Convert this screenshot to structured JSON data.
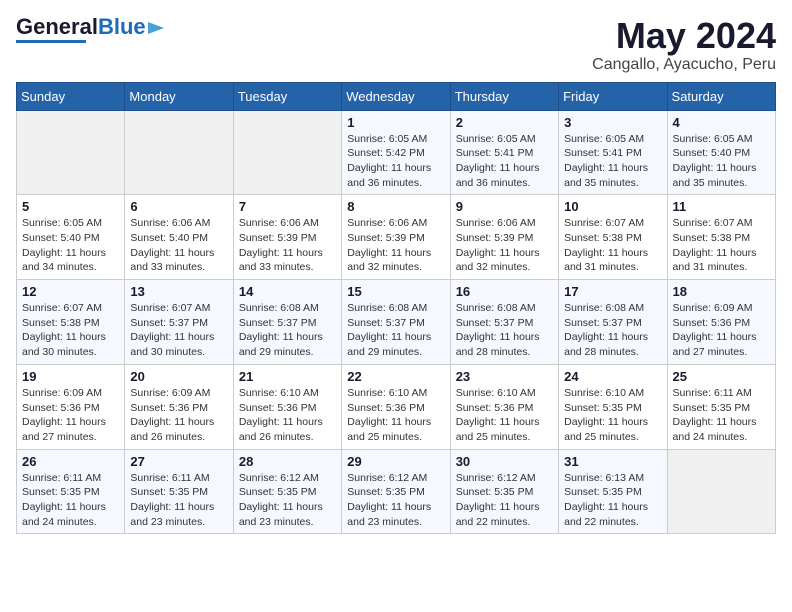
{
  "header": {
    "logo_line1": "General",
    "logo_line2": "Blue",
    "month": "May 2024",
    "location": "Cangallo, Ayacucho, Peru"
  },
  "weekdays": [
    "Sunday",
    "Monday",
    "Tuesday",
    "Wednesday",
    "Thursday",
    "Friday",
    "Saturday"
  ],
  "weeks": [
    [
      {
        "day": "",
        "info": ""
      },
      {
        "day": "",
        "info": ""
      },
      {
        "day": "",
        "info": ""
      },
      {
        "day": "1",
        "info": "Sunrise: 6:05 AM\nSunset: 5:42 PM\nDaylight: 11 hours\nand 36 minutes."
      },
      {
        "day": "2",
        "info": "Sunrise: 6:05 AM\nSunset: 5:41 PM\nDaylight: 11 hours\nand 36 minutes."
      },
      {
        "day": "3",
        "info": "Sunrise: 6:05 AM\nSunset: 5:41 PM\nDaylight: 11 hours\nand 35 minutes."
      },
      {
        "day": "4",
        "info": "Sunrise: 6:05 AM\nSunset: 5:40 PM\nDaylight: 11 hours\nand 35 minutes."
      }
    ],
    [
      {
        "day": "5",
        "info": "Sunrise: 6:05 AM\nSunset: 5:40 PM\nDaylight: 11 hours\nand 34 minutes."
      },
      {
        "day": "6",
        "info": "Sunrise: 6:06 AM\nSunset: 5:40 PM\nDaylight: 11 hours\nand 33 minutes."
      },
      {
        "day": "7",
        "info": "Sunrise: 6:06 AM\nSunset: 5:39 PM\nDaylight: 11 hours\nand 33 minutes."
      },
      {
        "day": "8",
        "info": "Sunrise: 6:06 AM\nSunset: 5:39 PM\nDaylight: 11 hours\nand 32 minutes."
      },
      {
        "day": "9",
        "info": "Sunrise: 6:06 AM\nSunset: 5:39 PM\nDaylight: 11 hours\nand 32 minutes."
      },
      {
        "day": "10",
        "info": "Sunrise: 6:07 AM\nSunset: 5:38 PM\nDaylight: 11 hours\nand 31 minutes."
      },
      {
        "day": "11",
        "info": "Sunrise: 6:07 AM\nSunset: 5:38 PM\nDaylight: 11 hours\nand 31 minutes."
      }
    ],
    [
      {
        "day": "12",
        "info": "Sunrise: 6:07 AM\nSunset: 5:38 PM\nDaylight: 11 hours\nand 30 minutes."
      },
      {
        "day": "13",
        "info": "Sunrise: 6:07 AM\nSunset: 5:37 PM\nDaylight: 11 hours\nand 30 minutes."
      },
      {
        "day": "14",
        "info": "Sunrise: 6:08 AM\nSunset: 5:37 PM\nDaylight: 11 hours\nand 29 minutes."
      },
      {
        "day": "15",
        "info": "Sunrise: 6:08 AM\nSunset: 5:37 PM\nDaylight: 11 hours\nand 29 minutes."
      },
      {
        "day": "16",
        "info": "Sunrise: 6:08 AM\nSunset: 5:37 PM\nDaylight: 11 hours\nand 28 minutes."
      },
      {
        "day": "17",
        "info": "Sunrise: 6:08 AM\nSunset: 5:37 PM\nDaylight: 11 hours\nand 28 minutes."
      },
      {
        "day": "18",
        "info": "Sunrise: 6:09 AM\nSunset: 5:36 PM\nDaylight: 11 hours\nand 27 minutes."
      }
    ],
    [
      {
        "day": "19",
        "info": "Sunrise: 6:09 AM\nSunset: 5:36 PM\nDaylight: 11 hours\nand 27 minutes."
      },
      {
        "day": "20",
        "info": "Sunrise: 6:09 AM\nSunset: 5:36 PM\nDaylight: 11 hours\nand 26 minutes."
      },
      {
        "day": "21",
        "info": "Sunrise: 6:10 AM\nSunset: 5:36 PM\nDaylight: 11 hours\nand 26 minutes."
      },
      {
        "day": "22",
        "info": "Sunrise: 6:10 AM\nSunset: 5:36 PM\nDaylight: 11 hours\nand 25 minutes."
      },
      {
        "day": "23",
        "info": "Sunrise: 6:10 AM\nSunset: 5:36 PM\nDaylight: 11 hours\nand 25 minutes."
      },
      {
        "day": "24",
        "info": "Sunrise: 6:10 AM\nSunset: 5:35 PM\nDaylight: 11 hours\nand 25 minutes."
      },
      {
        "day": "25",
        "info": "Sunrise: 6:11 AM\nSunset: 5:35 PM\nDaylight: 11 hours\nand 24 minutes."
      }
    ],
    [
      {
        "day": "26",
        "info": "Sunrise: 6:11 AM\nSunset: 5:35 PM\nDaylight: 11 hours\nand 24 minutes."
      },
      {
        "day": "27",
        "info": "Sunrise: 6:11 AM\nSunset: 5:35 PM\nDaylight: 11 hours\nand 23 minutes."
      },
      {
        "day": "28",
        "info": "Sunrise: 6:12 AM\nSunset: 5:35 PM\nDaylight: 11 hours\nand 23 minutes."
      },
      {
        "day": "29",
        "info": "Sunrise: 6:12 AM\nSunset: 5:35 PM\nDaylight: 11 hours\nand 23 minutes."
      },
      {
        "day": "30",
        "info": "Sunrise: 6:12 AM\nSunset: 5:35 PM\nDaylight: 11 hours\nand 22 minutes."
      },
      {
        "day": "31",
        "info": "Sunrise: 6:13 AM\nSunset: 5:35 PM\nDaylight: 11 hours\nand 22 minutes."
      },
      {
        "day": "",
        "info": ""
      }
    ]
  ]
}
